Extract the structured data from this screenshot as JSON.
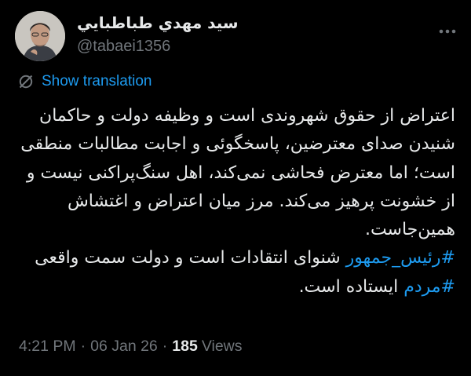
{
  "author": {
    "display_name": "سيد مهدي طباطبايي",
    "handle": "@tabaei1356"
  },
  "translate_label": "Show translation",
  "tweet": {
    "para1": "اعتراض از حقوق شهروندی است و وظیفه دولت و حاکمان شنیدن صدای معترضین، پاسخگوئی و اجابت مطالبات منطقی است؛ اما معترض فحاشی نمی‌کند، اهل سنگ‌پراکنی نیست و از خشونت پرهیز می‌کند. مرز میان اعتراض و اغتشاش همین‌جاست.",
    "hashtag1": "#رئیس_جمهور",
    "after_hashtag1": " شنوای انتقادات است و دولت سمت واقعی ",
    "hashtag2": "#مردم",
    "after_hashtag2": " ایستاده است."
  },
  "meta": {
    "time": "4:21 PM",
    "date": "06 Jan 26",
    "views_count": "185",
    "views_label": "Views"
  },
  "icons": {
    "more": "more-icon",
    "translate": "globe-strike-icon"
  },
  "colors": {
    "background": "#000000",
    "text": "#e7e9ea",
    "secondary": "#71767b",
    "link": "#1d9bf0"
  }
}
